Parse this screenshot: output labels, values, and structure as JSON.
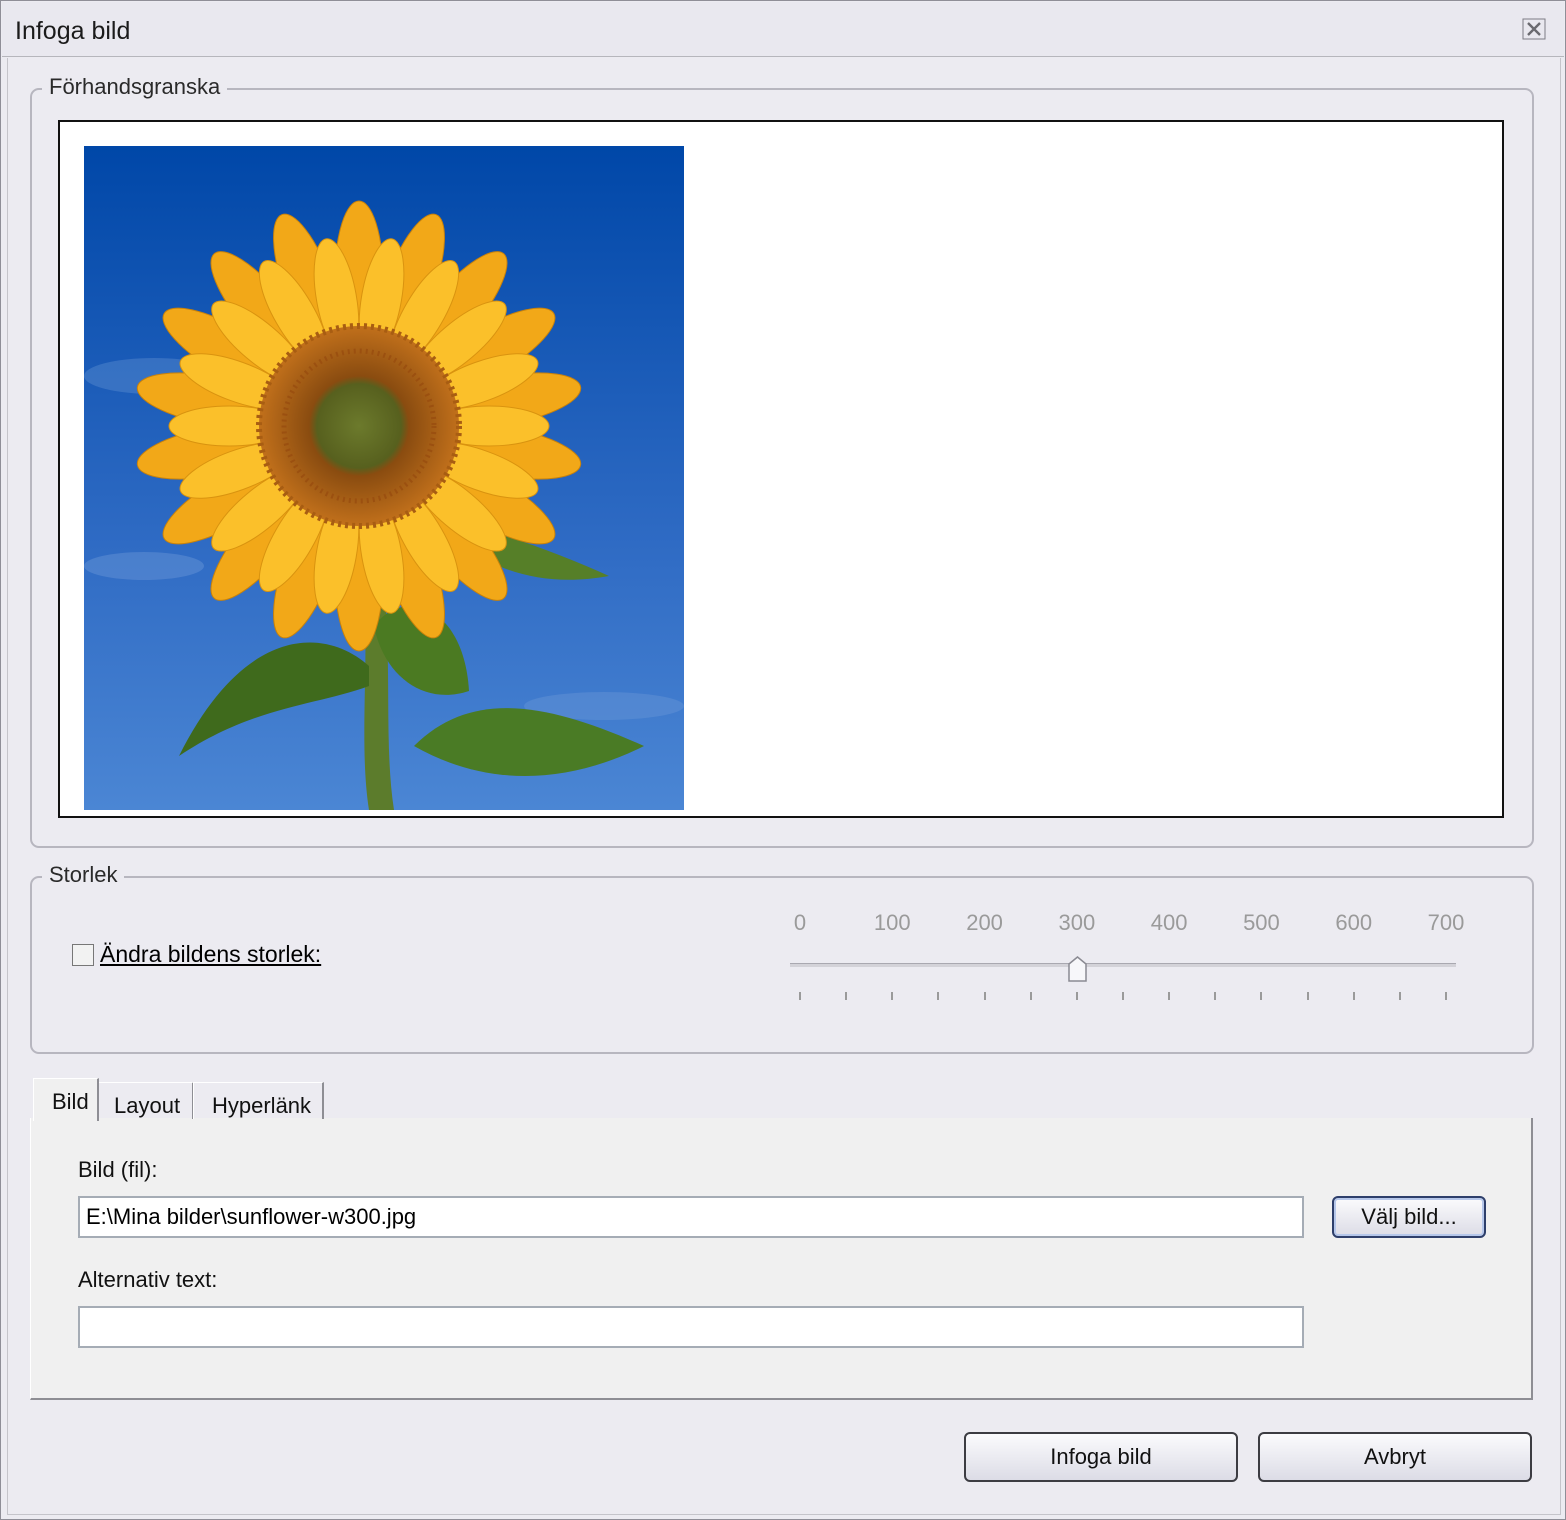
{
  "window": {
    "title": "Infoga bild"
  },
  "preview": {
    "legend": "Förhandsgranska"
  },
  "size": {
    "legend": "Storlek",
    "checkbox_label": "Ändra bildens storlek:",
    "checkbox_checked": false,
    "slider_ticks": [
      "0",
      "100",
      "200",
      "300",
      "400",
      "500",
      "600",
      "700"
    ],
    "slider_value": 300,
    "slider_max": 700
  },
  "tabs": [
    {
      "label": "Bild",
      "active": true
    },
    {
      "label": "Layout",
      "active": false
    },
    {
      "label": "Hyperlänk",
      "active": false
    }
  ],
  "image_tab": {
    "file_label": "Bild (fil):",
    "file_value": "E:\\Mina bilder\\sunflower-w300.jpg",
    "browse_label": "Välj bild...",
    "alt_label": "Alternativ text:",
    "alt_value": ""
  },
  "buttons": {
    "insert": "Infoga bild",
    "cancel": "Avbryt"
  }
}
